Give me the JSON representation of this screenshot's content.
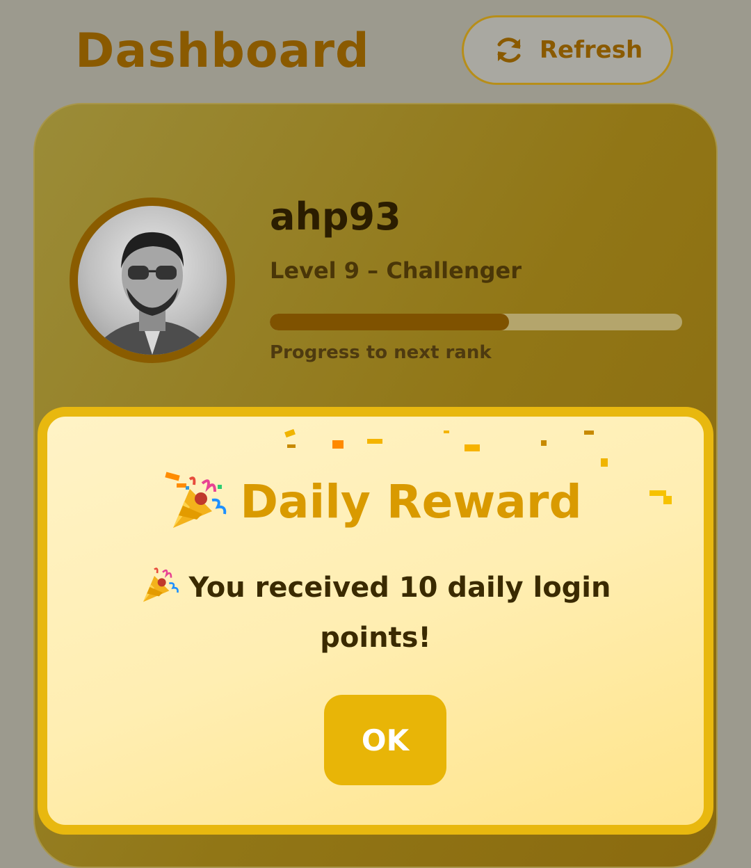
{
  "header": {
    "title": "Dashboard",
    "refresh_label": "Refresh",
    "refresh_icon": "refresh-icon"
  },
  "profile": {
    "username": "ahp93",
    "level_text": "Level 9 – Challenger",
    "progress_fraction": 0.58,
    "progress_label": "Progress to next rank",
    "avatar_icon": "avatar-photo"
  },
  "modal": {
    "title": "Daily Reward",
    "title_icon": "party-popper-icon",
    "message": "You received 10 daily login points!",
    "ok_label": "OK"
  },
  "colors": {
    "accent": "#e8b507",
    "brand_dark": "#8a5a00",
    "modal_title": "#d99a00"
  }
}
